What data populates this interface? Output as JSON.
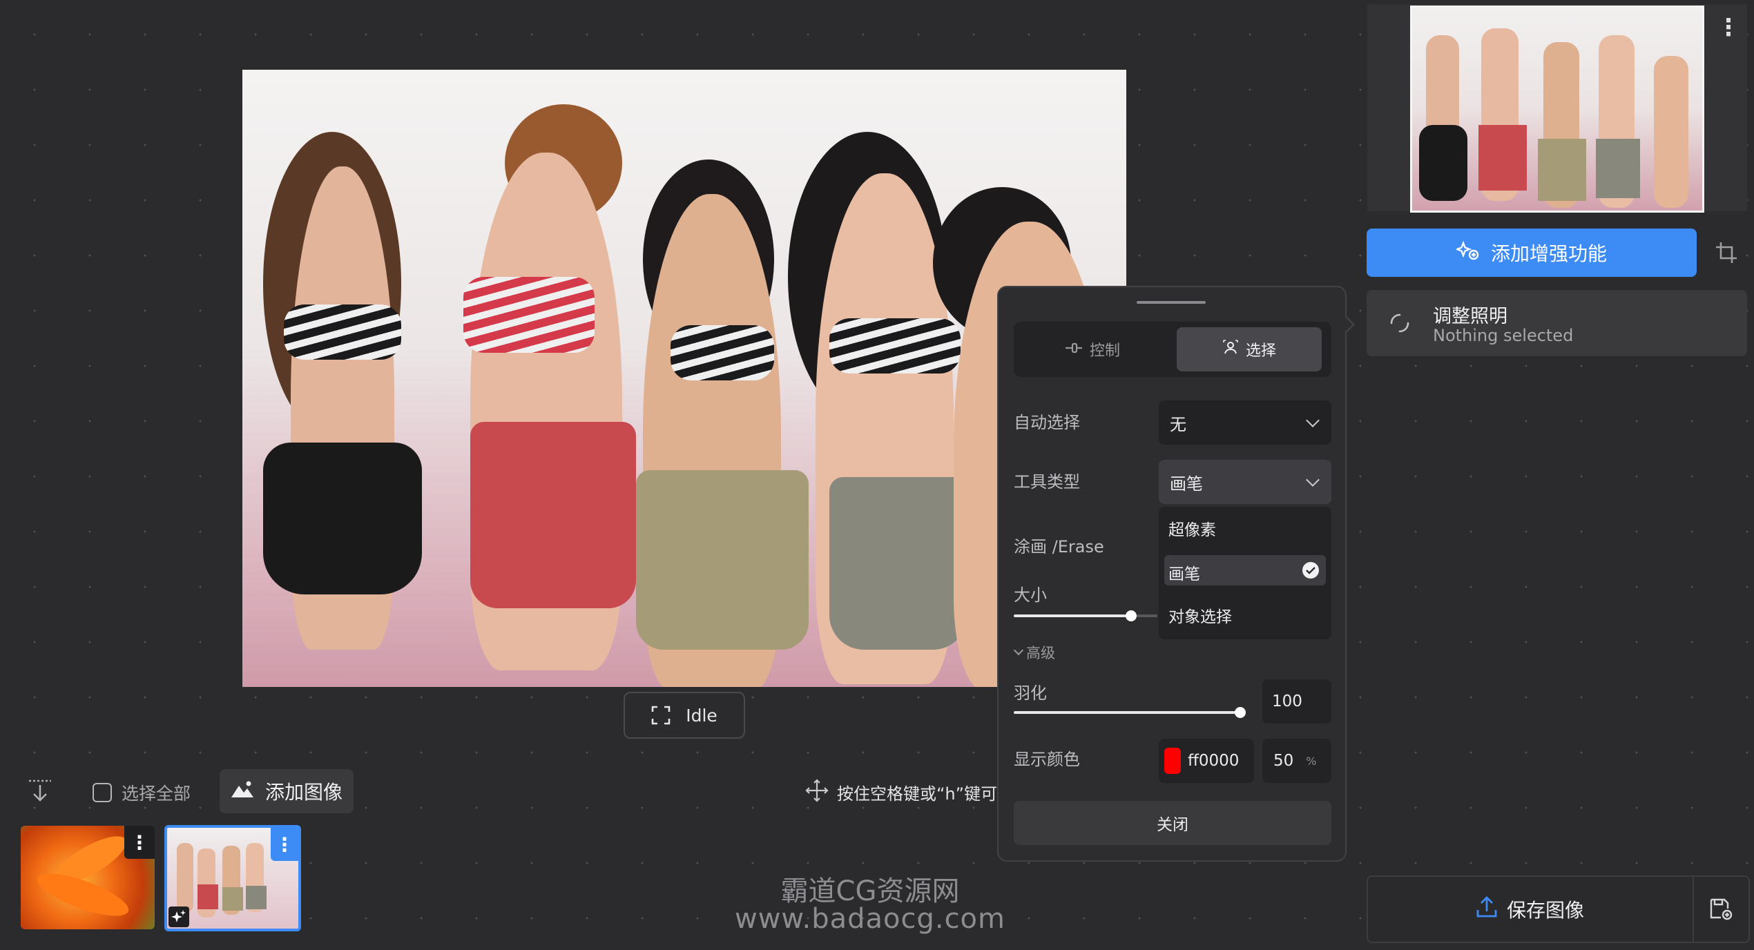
{
  "canvas": {
    "status_label": "Idle"
  },
  "toolbar": {
    "select_all_label": "选择全部",
    "add_image_label": "添加图像",
    "pan_hint": "按住空格键或“h”键可"
  },
  "thumbnails": [
    {
      "name": "flower-photo"
    },
    {
      "name": "group-photo",
      "selected": true
    }
  ],
  "right_panel": {
    "enhance_button_label": "添加增强功能",
    "adjust_lighting": {
      "title": "调整照明",
      "subtitle": "Nothing selected"
    },
    "save_button_label": "保存图像"
  },
  "popup": {
    "tabs": [
      {
        "label": "控制",
        "active": false
      },
      {
        "label": "选择",
        "active": true
      }
    ],
    "auto_select": {
      "label": "自动选择",
      "value": "无"
    },
    "tool_type": {
      "label": "工具类型",
      "value": "画笔",
      "options": [
        "超像素",
        "画笔",
        "对象选择"
      ],
      "selected_option": "画笔"
    },
    "paint_erase_label": "涂画 /Erase",
    "size": {
      "label": "大小",
      "value_fraction": 0.82
    },
    "advanced_label": "高级",
    "feather": {
      "label": "羽化",
      "value": "100"
    },
    "display_color": {
      "label": "显示颜色",
      "hex": "ff0000",
      "swatch": "#ff0000",
      "opacity": "50",
      "unit": "%"
    },
    "close_label": "关闭"
  },
  "watermark": {
    "line1": "霸道CG资源网",
    "line2": "www.badaocg.com"
  },
  "colors": {
    "accent": "#3d8cf5",
    "background": "#2b2b2d"
  }
}
